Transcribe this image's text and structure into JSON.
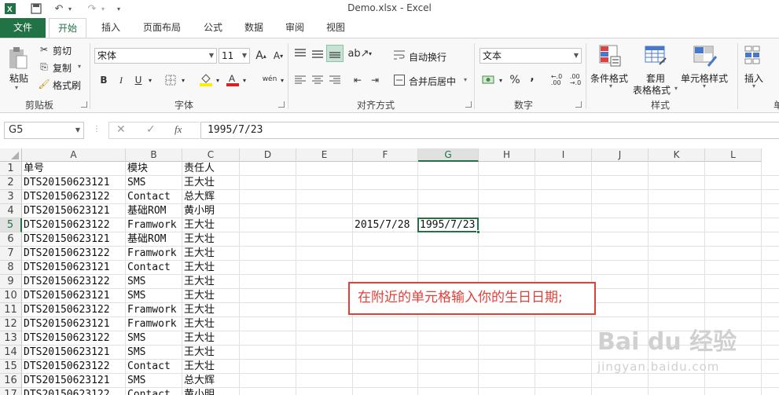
{
  "window": {
    "title": "Demo.xlsx - Excel",
    "quick_access": [
      "excel-logo-icon",
      "save-icon",
      "undo-icon",
      "redo-icon",
      "customize-icon"
    ]
  },
  "tabs": [
    "文件",
    "开始",
    "插入",
    "页面布局",
    "公式",
    "数据",
    "审阅",
    "视图"
  ],
  "ribbon": {
    "clipboard": {
      "paste": "粘贴",
      "cut": "剪切",
      "copy": "复制",
      "format_painter": "格式刷",
      "label": "剪贴板"
    },
    "font": {
      "name": "宋体",
      "size": "11",
      "bold": "B",
      "italic": "I",
      "underline": "U",
      "phonetic": "wén",
      "label": "字体"
    },
    "alignment": {
      "wrap": "自动换行",
      "merge": "合并后居中",
      "label": "对齐方式"
    },
    "number": {
      "format": "文本",
      "percent": "%",
      "comma": ",",
      "label": "数字"
    },
    "styles": {
      "conditional": "条件格式",
      "table": "套用",
      "table2": "表格格式",
      "cell_styles": "单元格样式",
      "label": "样式"
    },
    "cells": {
      "insert": "插入",
      "label": "单"
    }
  },
  "formula_bar": {
    "name_box": "G5",
    "cancel": "✕",
    "enter": "✓",
    "fx": "fx",
    "value": "1995/7/23"
  },
  "columns": [
    "A",
    "B",
    "C",
    "D",
    "E",
    "F",
    "G",
    "H",
    "I",
    "J",
    "K",
    "L"
  ],
  "rows": [
    "1",
    "2",
    "3",
    "4",
    "5",
    "6",
    "7",
    "8",
    "9",
    "10",
    "11",
    "12",
    "13",
    "14",
    "15",
    "16",
    "17"
  ],
  "cells": {
    "A": [
      "单号",
      "DTS20150623121",
      "DTS20150623122",
      "DTS20150623121",
      "DTS20150623122",
      "DTS20150623121",
      "DTS20150623122",
      "DTS20150623121",
      "DTS20150623122",
      "DTS20150623121",
      "DTS20150623122",
      "DTS20150623121",
      "DTS20150623122",
      "DTS20150623121",
      "DTS20150623122",
      "DTS20150623121",
      "DTS20150623122"
    ],
    "B": [
      "模块",
      "SMS",
      "Contact",
      "基础ROM",
      "Framwork",
      "基础ROM",
      "Framwork",
      "Contact",
      "SMS",
      "SMS",
      "Framwork",
      "Framwork",
      "SMS",
      "SMS",
      "Contact",
      "SMS",
      "Contact"
    ],
    "C": [
      "责任人",
      "王大壮",
      "总大辉",
      "黄小明",
      "王大壮",
      "王大壮",
      "王大壮",
      "王大壮",
      "王大壮",
      "王大壮",
      "王大壮",
      "王大壮",
      "王大壮",
      "王大壮",
      "王大壮",
      "总大辉",
      "黄小明"
    ],
    "F5": "2015/7/28",
    "G5": "1995/7/23"
  },
  "annotation": "在附近的单元格输入你的生日日期;",
  "watermark": {
    "brand": "Bai du 经验",
    "url": "jingyan.baidu.com"
  },
  "colors": {
    "excel_green": "#217346",
    "note_red": "#e0403a"
  }
}
